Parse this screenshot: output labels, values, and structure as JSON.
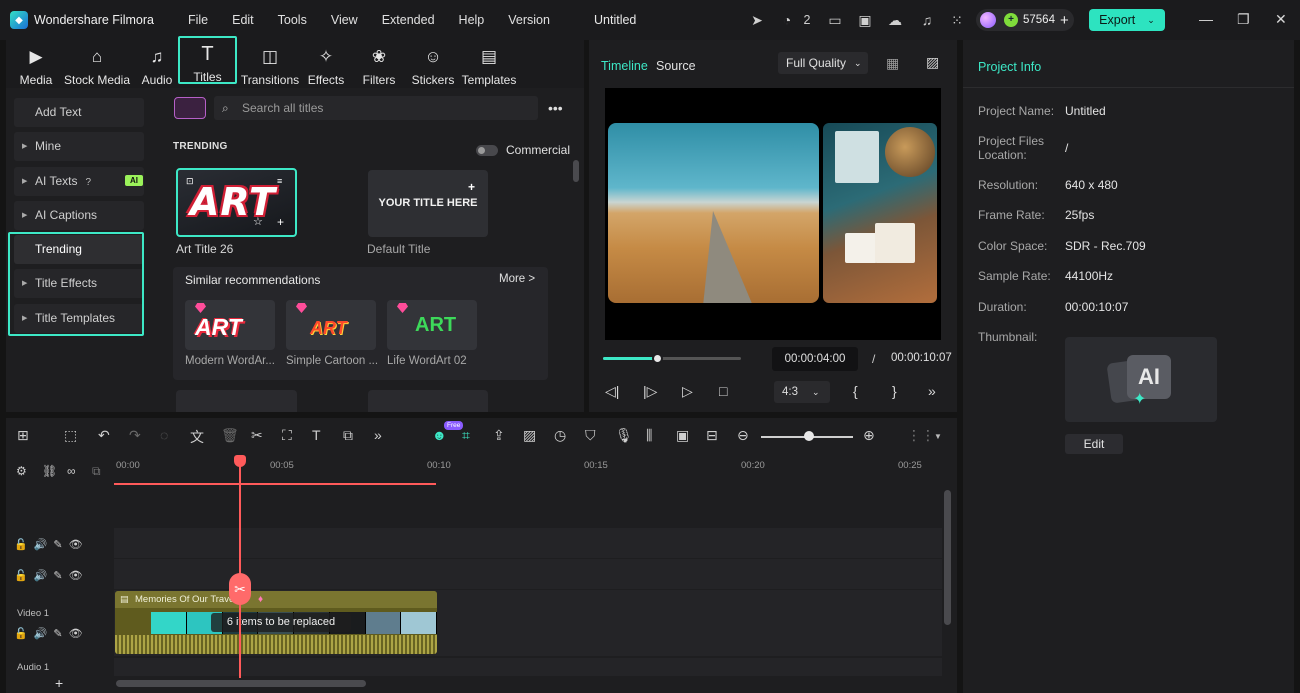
{
  "app": {
    "name": "Wondershare Filmora",
    "doc_title": "Untitled"
  },
  "menu": [
    "File",
    "Edit",
    "Tools",
    "View",
    "Extended",
    "Help",
    "Version"
  ],
  "toolbar": {
    "cloud_count": "2",
    "credits": "57564",
    "export_label": "Export"
  },
  "library_tabs": [
    {
      "label": "Media",
      "icon": "media-icon"
    },
    {
      "label": "Stock Media",
      "icon": "stock-media-icon"
    },
    {
      "label": "Audio",
      "icon": "music-note-icon"
    },
    {
      "label": "Titles",
      "icon": "title-t-icon",
      "active": true
    },
    {
      "label": "Transitions",
      "icon": "transition-icon"
    },
    {
      "label": "Effects",
      "icon": "effects-star-icon"
    },
    {
      "label": "Filters",
      "icon": "filters-icon"
    },
    {
      "label": "Stickers",
      "icon": "sticker-icon"
    },
    {
      "label": "Templates",
      "icon": "templates-icon"
    }
  ],
  "categories": {
    "add_text": "Add Text",
    "mine": "Mine",
    "ai_texts": "AI Texts",
    "ai_badge": "AI",
    "ai_captions": "AI Captions",
    "trending": "Trending",
    "title_effects": "Title Effects",
    "title_templates": "Title Templates"
  },
  "search": {
    "placeholder": "Search all titles"
  },
  "trending": {
    "heading": "TRENDING",
    "commercial": "Commercial",
    "items": [
      {
        "art": "ART",
        "caption": "Art Title 26"
      },
      {
        "art": "YOUR TITLE HERE",
        "caption": "Default Title"
      }
    ]
  },
  "similar": {
    "heading": "Similar recommendations",
    "more": "More >",
    "items": [
      {
        "art": "ART",
        "caption": "Modern WordAr...",
        "color": "#e8293c"
      },
      {
        "art": "ART",
        "caption": "Simple Cartoon ...",
        "color": "#ff4a2a"
      },
      {
        "art": "ART",
        "caption": "Life WordArt 02",
        "color": "#3dd95a"
      }
    ]
  },
  "preview": {
    "tab_timeline": "Timeline",
    "tab_source": "Source",
    "quality": "Full Quality",
    "current_time": "00:00:04:00",
    "separator": "/",
    "total_time": "00:00:10:07",
    "ratio": "4:3",
    "progress": 0.39
  },
  "project_info": {
    "heading": "Project Info",
    "rows": [
      {
        "label": "Project Name:",
        "value": "Untitled"
      },
      {
        "label": "Project Files Location:",
        "value": "/"
      },
      {
        "label": "Resolution:",
        "value": "640 x 480"
      },
      {
        "label": "Frame Rate:",
        "value": "25fps"
      },
      {
        "label": "Color Space:",
        "value": "SDR - Rec.709"
      },
      {
        "label": "Sample Rate:",
        "value": "44100Hz"
      },
      {
        "label": "Duration:",
        "value": "00:00:10:07"
      }
    ],
    "thumbnail_label": "Thumbnail:",
    "edit_label": "Edit"
  },
  "timeline": {
    "ruler": [
      "00:00",
      "00:05",
      "00:10",
      "00:15",
      "00:20",
      "00:25"
    ],
    "clip_title": "Memories Of Our Trave",
    "replace_text": "6 items to be replaced",
    "track_video": "Video 1",
    "track_audio": "Audio 1",
    "add_track": "+",
    "free_badge": "Free"
  },
  "colors": {
    "accent": "#3de8c6",
    "playhead": "#ff5a5a",
    "export": "#2de3c0"
  }
}
